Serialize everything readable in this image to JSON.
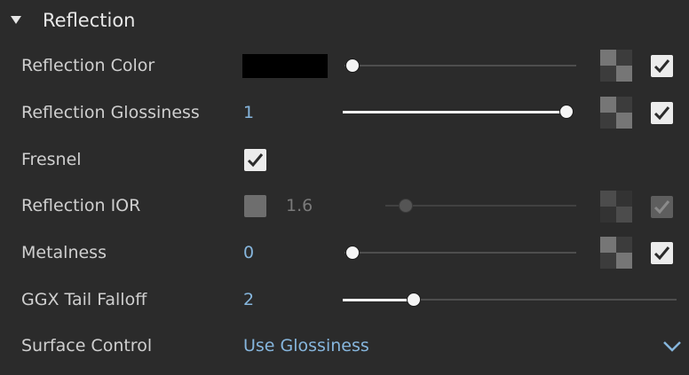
{
  "section": {
    "title": "Reflection"
  },
  "rows": {
    "reflection_color": {
      "label": "Reflection Color",
      "color": "#000000",
      "slider_value": 0.0,
      "map_enabled": true
    },
    "reflection_glossiness": {
      "label": "Reflection Glossiness",
      "value": "1",
      "slider_value": 1.0,
      "map_enabled": true
    },
    "fresnel": {
      "label": "Fresnel",
      "checked": true
    },
    "reflection_ior": {
      "label": "Reflection IOR",
      "value": "1.6",
      "lock_checked": false,
      "slider_value": 0.1,
      "map_enabled": true,
      "disabled": true
    },
    "metalness": {
      "label": "Metalness",
      "value": "0",
      "slider_value": 0.0,
      "map_enabled": true
    },
    "ggx_tail_falloff": {
      "label": "GGX Tail Falloff",
      "value": "2",
      "slider_value": 0.2
    },
    "surface_control": {
      "label": "Surface Control",
      "value": "Use Glossiness"
    }
  },
  "colors": {
    "accent_value": "#86b6dd",
    "background": "#2b2b2b"
  }
}
